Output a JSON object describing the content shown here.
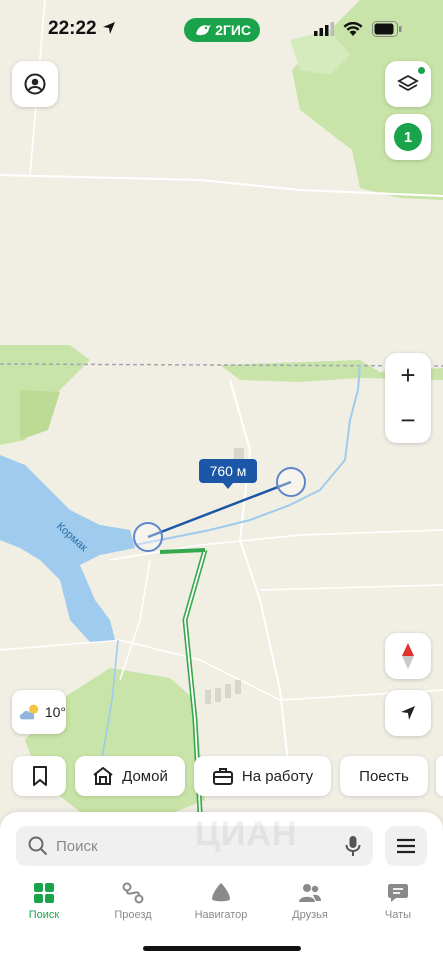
{
  "status_bar": {
    "time": "22:22"
  },
  "brand": {
    "label": "2ГИС"
  },
  "controls": {
    "notification_count": "1",
    "zoom_in": "+",
    "zoom_out": "−"
  },
  "map": {
    "river_label": "Кормак",
    "distance_label": "760 м"
  },
  "weather": {
    "temperature": "10°",
    "icon": "cloud-sun-icon"
  },
  "quick_chips": [
    {
      "label": "",
      "icon": "bookmark-icon"
    },
    {
      "label": "Домой",
      "icon": "home-icon"
    },
    {
      "label": "На работу",
      "icon": "briefcase-icon"
    },
    {
      "label": "Поесть",
      "icon": ""
    }
  ],
  "search": {
    "placeholder": "Поиск"
  },
  "watermark": "ЦИАН",
  "tabs": [
    {
      "label": "Поиск",
      "icon": "grid-icon",
      "active": true
    },
    {
      "label": "Проезд",
      "icon": "route-icon",
      "active": false
    },
    {
      "label": "Навигатор",
      "icon": "navigator-icon",
      "active": false
    },
    {
      "label": "Друзья",
      "icon": "friends-icon",
      "active": false
    },
    {
      "label": "Чаты",
      "icon": "chat-icon",
      "active": false
    }
  ],
  "colors": {
    "accent": "#1aa34a",
    "water": "#9ecbee",
    "forest": "#c7e3a6",
    "measure_line": "#1c56a6"
  }
}
